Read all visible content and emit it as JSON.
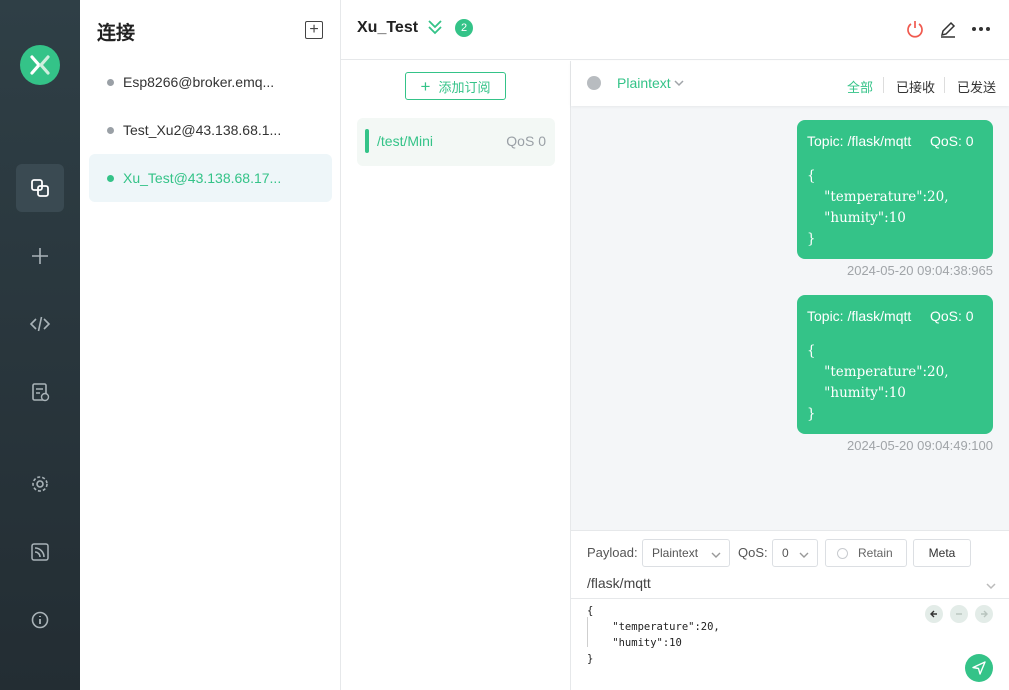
{
  "rail": {
    "logo_icon": "mqttx-logo-icon",
    "items": [
      {
        "icon": "connections-icon",
        "active": true
      },
      {
        "icon": "plus-icon"
      },
      {
        "icon": "code-icon"
      },
      {
        "icon": "log-icon"
      },
      {
        "icon": "gear-icon"
      },
      {
        "icon": "rss-icon"
      },
      {
        "icon": "info-icon"
      }
    ]
  },
  "connections": {
    "title": "连接",
    "items": [
      {
        "label": "Esp8266@broker.emq...",
        "active": false
      },
      {
        "label": "Test_Xu2@43.138.68.1...",
        "active": false
      },
      {
        "label": "Xu_Test@43.138.68.17...",
        "active": true
      }
    ]
  },
  "header": {
    "title": "Xu_Test",
    "badge": "2"
  },
  "subscriptions": {
    "add_label": "添加订阅",
    "items": [
      {
        "topic": "/test/Mini",
        "qos": "QoS 0",
        "color": "#34c388"
      }
    ]
  },
  "messages": {
    "payload_type": "Plaintext",
    "filters": [
      "全部",
      "已接收",
      "已发送"
    ],
    "list": [
      {
        "topic": "Topic: /flask/mqtt",
        "qos": "QoS: 0",
        "body": "{\n    \"temperature\":20,\n    \"humity\":10\n}",
        "time": "2024-05-20 09:04:38:965"
      },
      {
        "topic": "Topic: /flask/mqtt",
        "qos": "QoS: 0",
        "body": "{\n    \"temperature\":20,\n    \"humity\":10\n}",
        "time": "2024-05-20 09:04:49:100"
      }
    ]
  },
  "composer": {
    "payload_label": "Payload:",
    "payload_format": "Plaintext",
    "qos_label": "QoS:",
    "qos_value": "0",
    "retain_label": "Retain",
    "meta_label": "Meta",
    "topic": "/flask/mqtt",
    "payload": "{\n    \"temperature\":20,\n    \"humity\":10\n}"
  },
  "colors": {
    "accent": "#34c388",
    "rail_bg": "#2a373d",
    "disconnect": "#f05a4f"
  }
}
